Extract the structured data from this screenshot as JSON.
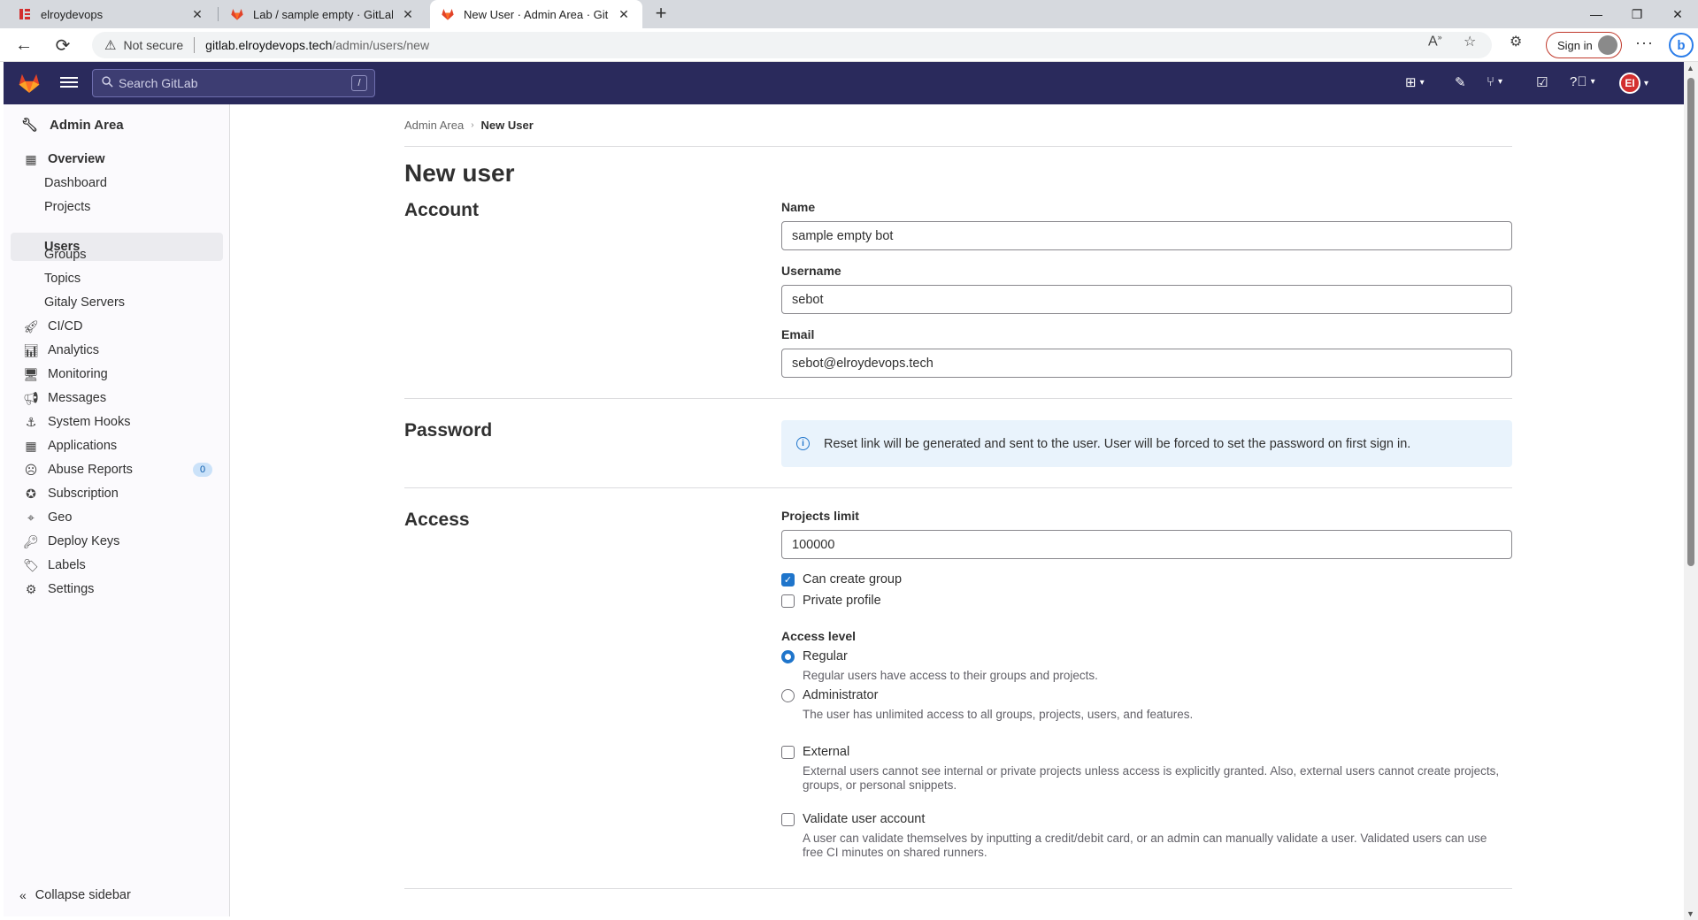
{
  "browser": {
    "tabs": [
      {
        "title": "elroydevops",
        "active": false
      },
      {
        "title": "Lab / sample empty · GitLab",
        "active": false
      },
      {
        "title": "New User · Admin Area · GitLab",
        "active": true
      }
    ],
    "security_label": "Not secure",
    "url_host": "gitlab.elroydevops.tech",
    "url_path": "/admin/users/new",
    "sign_in_label": "Sign in"
  },
  "gitlab_nav": {
    "search_placeholder": "Search GitLab",
    "search_shortcut": "/",
    "avatar_initials": "EI"
  },
  "sidebar": {
    "title": "Admin Area",
    "items": [
      {
        "label": "Overview",
        "icon": "overview-icon",
        "type": "section"
      },
      {
        "label": "Dashboard",
        "type": "sub"
      },
      {
        "label": "Projects",
        "type": "sub"
      },
      {
        "label": "Users",
        "type": "sub",
        "active": true
      },
      {
        "label": "Groups",
        "type": "sub"
      },
      {
        "label": "Topics",
        "type": "sub"
      },
      {
        "label": "Gitaly Servers",
        "type": "sub"
      },
      {
        "label": "CI/CD",
        "icon": "rocket-icon"
      },
      {
        "label": "Analytics",
        "icon": "chart-icon"
      },
      {
        "label": "Monitoring",
        "icon": "monitor-icon"
      },
      {
        "label": "Messages",
        "icon": "bullhorn-icon"
      },
      {
        "label": "System Hooks",
        "icon": "hook-icon"
      },
      {
        "label": "Applications",
        "icon": "apps-icon"
      },
      {
        "label": "Abuse Reports",
        "icon": "abuse-icon",
        "badge": "0"
      },
      {
        "label": "Subscription",
        "icon": "license-icon"
      },
      {
        "label": "Geo",
        "icon": "location-icon"
      },
      {
        "label": "Deploy Keys",
        "icon": "key-icon"
      },
      {
        "label": "Labels",
        "icon": "label-icon"
      },
      {
        "label": "Settings",
        "icon": "settings-icon"
      }
    ],
    "collapse_label": "Collapse sidebar"
  },
  "breadcrumb": {
    "parent": "Admin Area",
    "current": "New User"
  },
  "page": {
    "title": "New user",
    "account": {
      "heading": "Account",
      "name_label": "Name",
      "name_value": "sample empty bot",
      "username_label": "Username",
      "username_value": "sebot",
      "email_label": "Email",
      "email_value": "sebot@elroydevops.tech"
    },
    "password": {
      "heading": "Password",
      "info": "Reset link will be generated and sent to the user. User will be forced to set the password on first sign in."
    },
    "access": {
      "heading": "Access",
      "projects_limit_label": "Projects limit",
      "projects_limit_value": "100000",
      "can_create_group_label": "Can create group",
      "can_create_group_checked": true,
      "private_profile_label": "Private profile",
      "private_profile_checked": false,
      "access_level_label": "Access level",
      "regular_label": "Regular",
      "regular_help": "Regular users have access to their groups and projects.",
      "regular_selected": true,
      "admin_label": "Administrator",
      "admin_help": "The user has unlimited access to all groups, projects, users, and features.",
      "external_label": "External",
      "external_help": "External users cannot see internal or private projects unless access is explicitly granted. Also, external users cannot create projects, groups, or personal snippets.",
      "validate_label": "Validate user account",
      "validate_help": "A user can validate themselves by inputting a credit/debit card, or an admin can manually validate a user. Validated users can use free CI minutes on shared runners."
    }
  },
  "colors": {
    "nav_bg": "#2a2a5c",
    "accent": "#1f75cb",
    "alert_bg": "#e9f3fc"
  }
}
